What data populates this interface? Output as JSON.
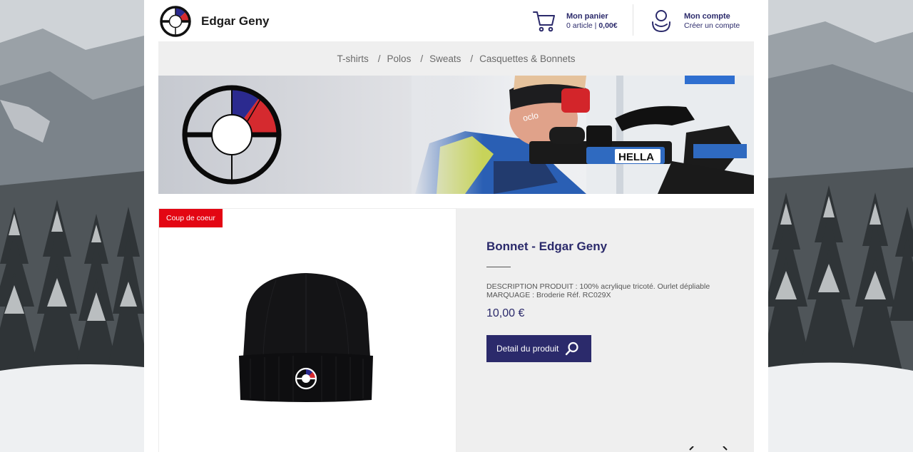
{
  "header": {
    "brand": "Edgar Geny",
    "cart": {
      "title": "Mon panier",
      "count_text": "0 article",
      "total": "0,00€"
    },
    "account": {
      "title": "Mon compte",
      "subtitle": "Créer un compte"
    }
  },
  "nav": {
    "items": [
      {
        "label": "T-shirts"
      },
      {
        "label": "Polos"
      },
      {
        "label": "Sweats"
      },
      {
        "label": "Casquettes & Bonnets"
      }
    ],
    "separator": "/"
  },
  "banner": {
    "text_hella": "HELLA",
    "text_oclo": "oclo"
  },
  "product": {
    "badge": "Coup de coeur",
    "title": "Bonnet - Edgar Geny",
    "description_line1": "DESCRIPTION PRODUIT : 100% acrylique tricoté. Ourlet dépliable",
    "description_line2": "MARQUAGE : Broderie Réf. RC029X",
    "price": "10,00 €",
    "detail_button": "Detail du produit"
  },
  "colors": {
    "brand_navy": "#2b2a6b",
    "badge_red": "#e30613",
    "logo_blue": "#2b2a8f",
    "logo_red": "#d52a2f",
    "nav_bg": "#efefef"
  },
  "icons": {
    "cart": "cart-icon",
    "account": "user-icon",
    "detail": "search-icon",
    "prev": "chevron-left-icon",
    "next": "chevron-right-icon"
  }
}
